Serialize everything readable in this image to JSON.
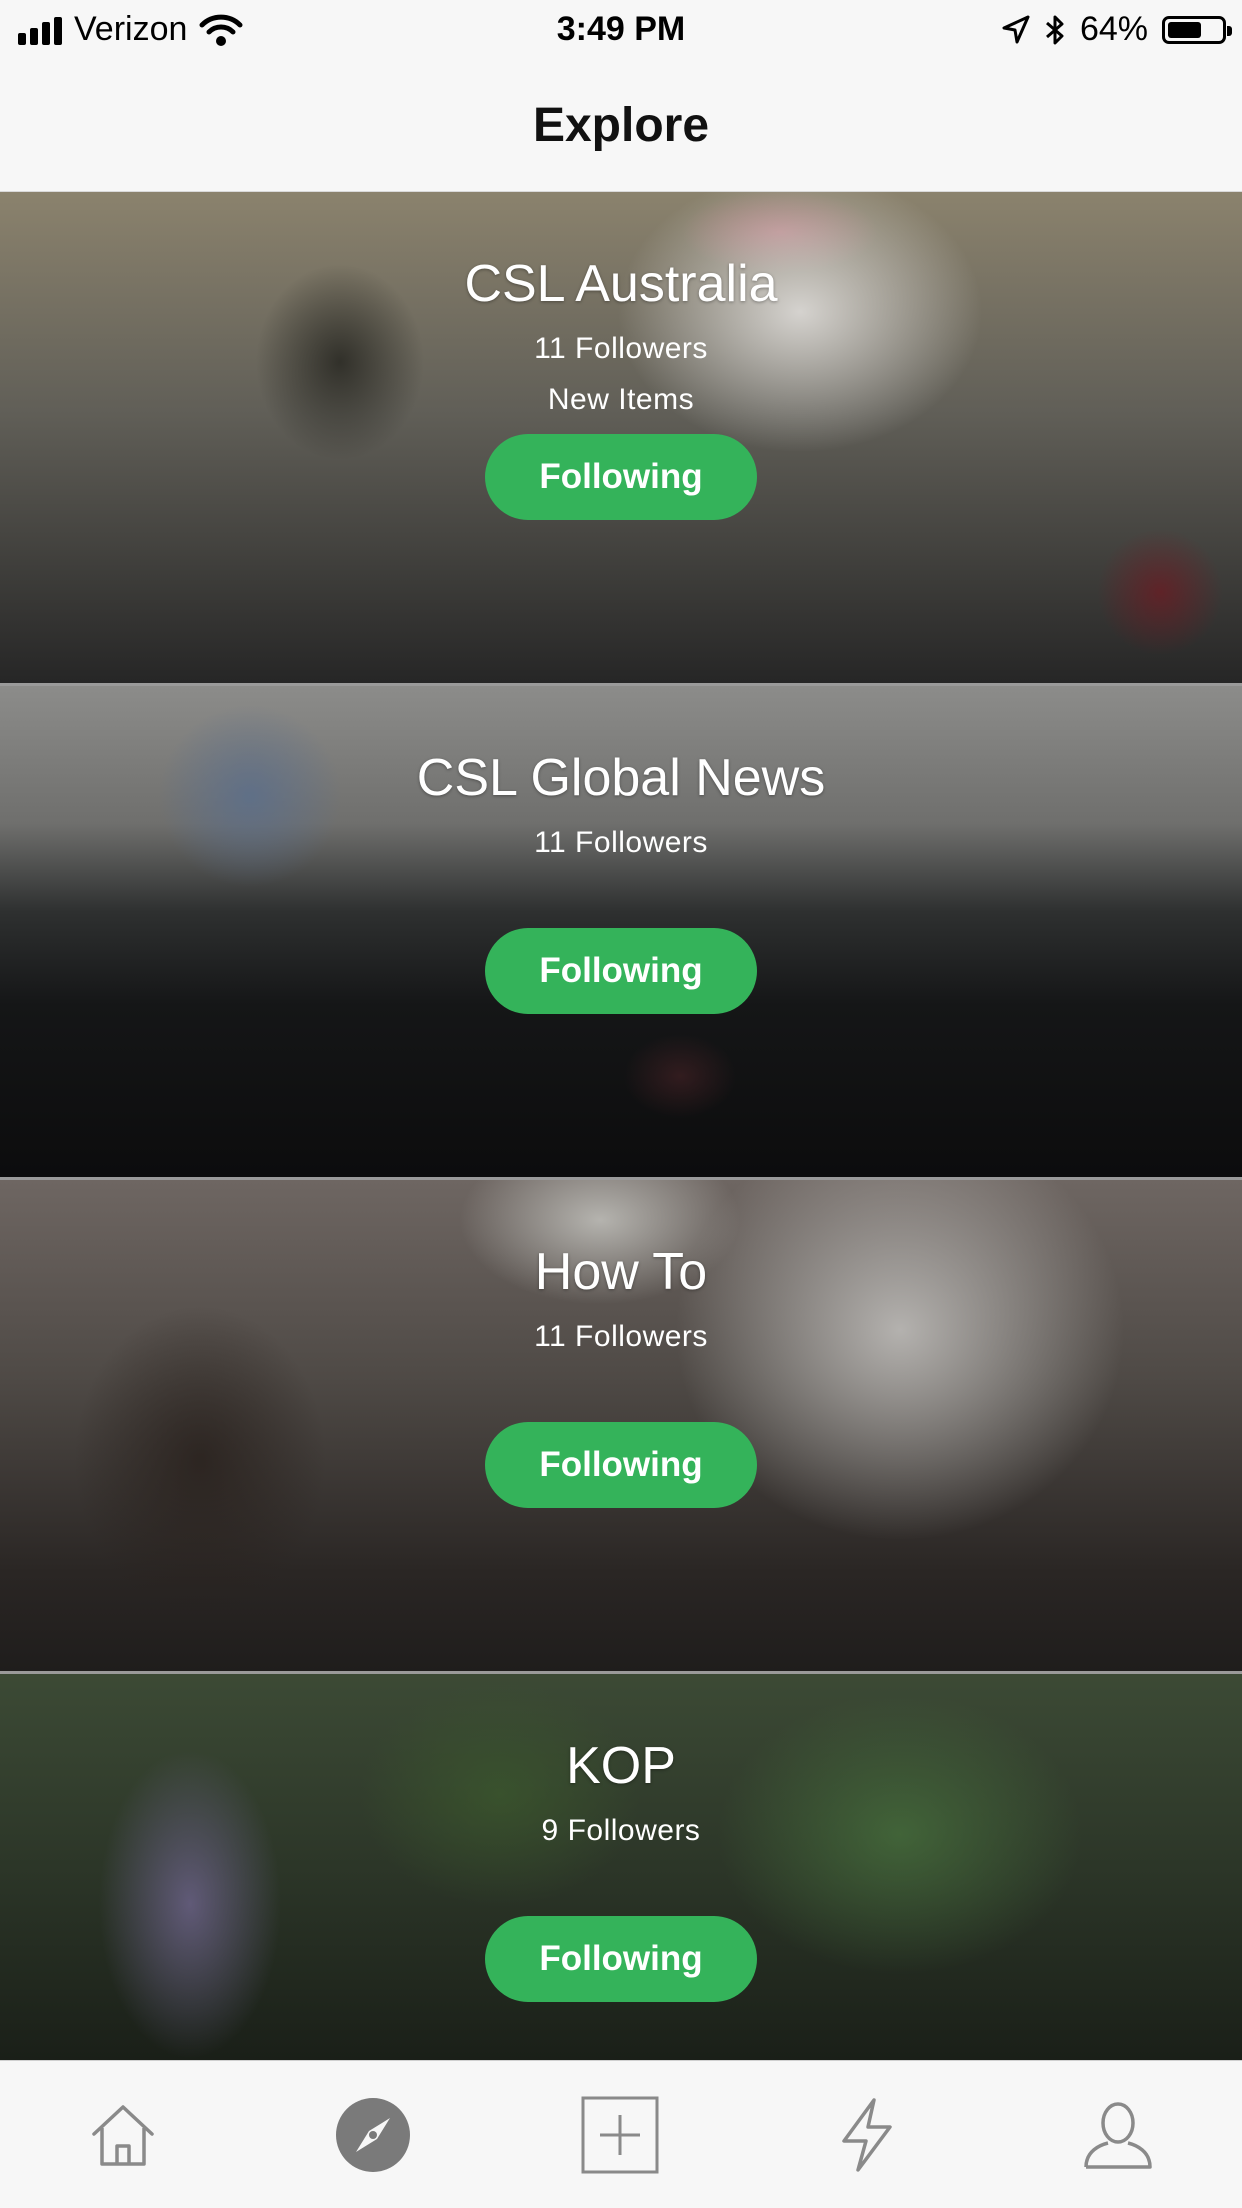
{
  "status_bar": {
    "carrier": "Verizon",
    "time": "3:49 PM",
    "battery_percent": "64%",
    "battery_level": 0.64,
    "icons": [
      "signal-icon",
      "wifi-icon",
      "location-arrow-icon",
      "bluetooth-icon",
      "battery-icon"
    ]
  },
  "nav": {
    "title": "Explore"
  },
  "colors": {
    "accent_green": "#34b35a",
    "tab_active": "#7a7a7a",
    "tab_inactive": "#8a8a8a"
  },
  "cards": [
    {
      "title": "CSL Australia",
      "followers": "11 Followers",
      "extra": "New Items",
      "button": "Following"
    },
    {
      "title": "CSL Global News",
      "followers": "11 Followers",
      "extra": "",
      "button": "Following"
    },
    {
      "title": "How To",
      "followers": "11 Followers",
      "extra": "",
      "button": "Following"
    },
    {
      "title": "KOP",
      "followers": "9 Followers",
      "extra": "",
      "button": "Following"
    }
  ],
  "tab_bar": {
    "tabs": [
      {
        "icon": "home-icon",
        "active": false
      },
      {
        "icon": "compass-icon",
        "active": true
      },
      {
        "icon": "add-square-icon",
        "active": false
      },
      {
        "icon": "lightning-icon",
        "active": false
      },
      {
        "icon": "profile-icon",
        "active": false
      }
    ]
  }
}
